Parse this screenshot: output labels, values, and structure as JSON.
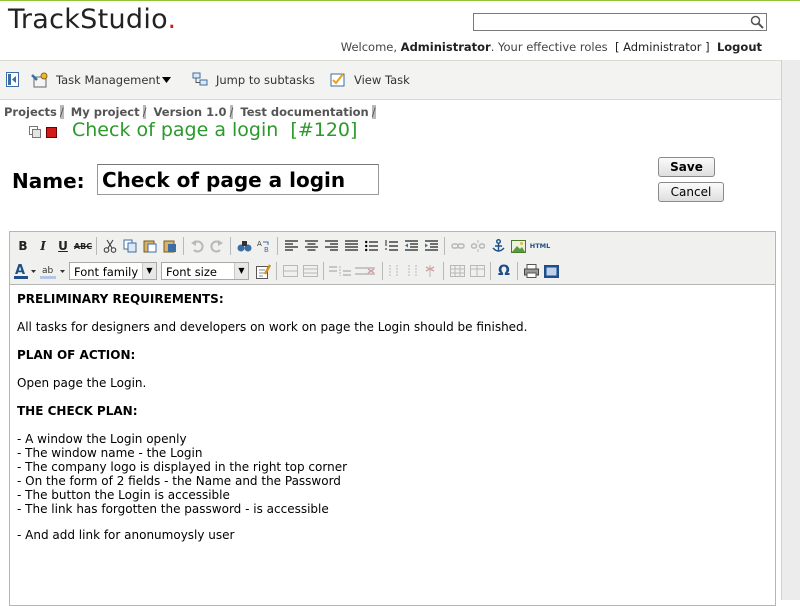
{
  "header": {
    "logo_main": "TrackStudio",
    "logo_dot": ".",
    "welcome_prefix": "Welcome,",
    "user_name": "Administrator",
    "roles_text": ". Your effective roles",
    "role": "[ Administrator ]",
    "logout": "Logout",
    "search": {
      "value": "",
      "placeholder": ""
    }
  },
  "nav": {
    "task_management": "Task Management",
    "jump_to_subtasks": "Jump to subtasks",
    "view_task": "View Task"
  },
  "breadcrumb": [
    "Projects",
    "My project",
    "Version 1.0",
    "Test documentation"
  ],
  "task": {
    "title": "Check of page a login",
    "number": "[#120]"
  },
  "form": {
    "name_label": "Name:",
    "name_value": "Check of page a login",
    "save_label": "Save",
    "cancel_label": "Cancel"
  },
  "editor_toolbar": {
    "font_family": "Font family",
    "font_size": "Font size",
    "bold": "B",
    "italic": "I",
    "underline": "U",
    "strike": "ABC",
    "html": "HTML",
    "omega": "Ω"
  },
  "description": {
    "h1": "PRELIMINARY REQUIREMENTS:",
    "p1": "All tasks for designers and developers on work on page the Login should be finished.",
    "h2": "PLAN OF ACTION:",
    "p2": "Open page the Login.",
    "h3": "THE CHECK PLAN:",
    "list": [
      "- A window the Login openly",
      "- The window name - the Login",
      "- The company logo is displayed in the right top corner",
      "- On the form of 2 fields - the Name and the Password",
      "- The button the Login is accessible",
      "- The link has forgotten the password - is accessible"
    ],
    "extra": "- And add link for anonumoysly user"
  },
  "colors": {
    "accent_green": "#2b9a2b",
    "logo_dot": "#c8201e"
  }
}
